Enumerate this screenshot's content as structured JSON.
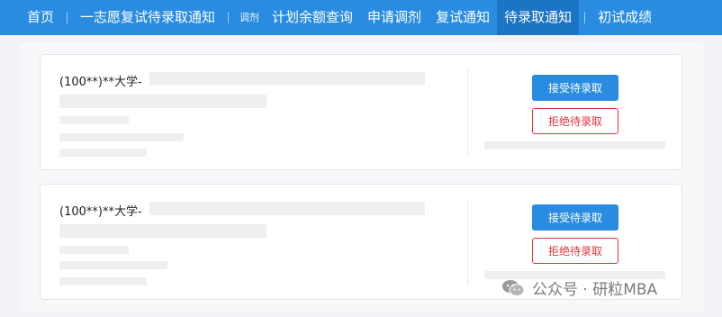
{
  "nav": {
    "items": [
      {
        "label": "首页"
      },
      {
        "label": "一志愿复试待录取通知"
      },
      {
        "label": "调剂"
      },
      {
        "label": "计划余额查询"
      },
      {
        "label": "申请调剂"
      },
      {
        "label": "复试通知"
      },
      {
        "label": "待录取通知"
      },
      {
        "label": "初试成绩"
      }
    ],
    "active_index": 6
  },
  "cards": [
    {
      "school": "(100**)**大学-",
      "accept_label": "接受待录取",
      "reject_label": "拒绝待录取"
    },
    {
      "school": "(100**)**大学-",
      "accept_label": "接受待录取",
      "reject_label": "拒绝待录取"
    }
  ],
  "watermark": {
    "text": "公众号 · 研粒MBA",
    "icon": "wechat-icon"
  },
  "colors": {
    "nav_bg": "#2a8ce0",
    "nav_active": "#1c74c4",
    "accept": "#2a8ce0",
    "reject": "#e0363b"
  }
}
